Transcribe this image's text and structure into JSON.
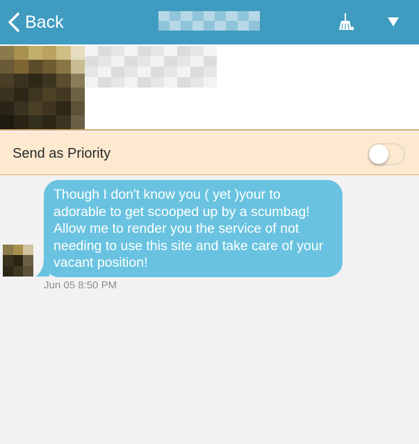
{
  "navbar": {
    "back_label": "Back",
    "back_icon": "chevron-left-icon",
    "cleanup_icon": "broom-icon",
    "menu_icon": "caret-down-icon",
    "bar_color": "#3f9cc0"
  },
  "priority": {
    "label": "Send as Priority",
    "enabled": false
  },
  "messages": [
    {
      "text": "Though I don't know you ( yet )your to adorable to get scooped up by a scumbag! Allow me to render you the service of not needing to use this site and take care of your vacant position!",
      "timestamp": "Jun 05 8:50 PM",
      "bubble_color": "#69c3e0"
    }
  ]
}
